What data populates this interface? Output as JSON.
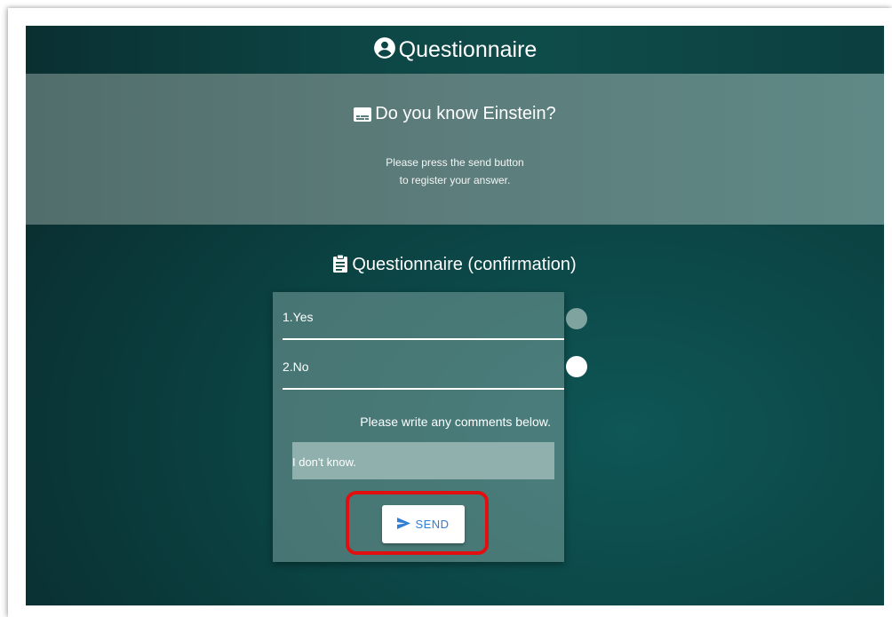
{
  "header": {
    "title": "Questionnaire",
    "icon": "account-circle-icon"
  },
  "banner": {
    "title": "Do you know Einstein?",
    "icon": "subtitles-icon",
    "desc_line1": "Please press the send button",
    "desc_line2": "to register your answer."
  },
  "questionnaire": {
    "title": "Questionnaire (confirmation)",
    "icon": "clipboard-icon",
    "options": [
      {
        "label": "1.Yes",
        "selected": false
      },
      {
        "label": "2.No",
        "selected": true
      }
    ],
    "comment_label": "Please write any comments below.",
    "comment_value": "I don't know.",
    "send_label": "SEND",
    "send_icon": "send-icon"
  },
  "colors": {
    "highlight": "#e10f0f",
    "send_text": "#2f7fd6"
  }
}
